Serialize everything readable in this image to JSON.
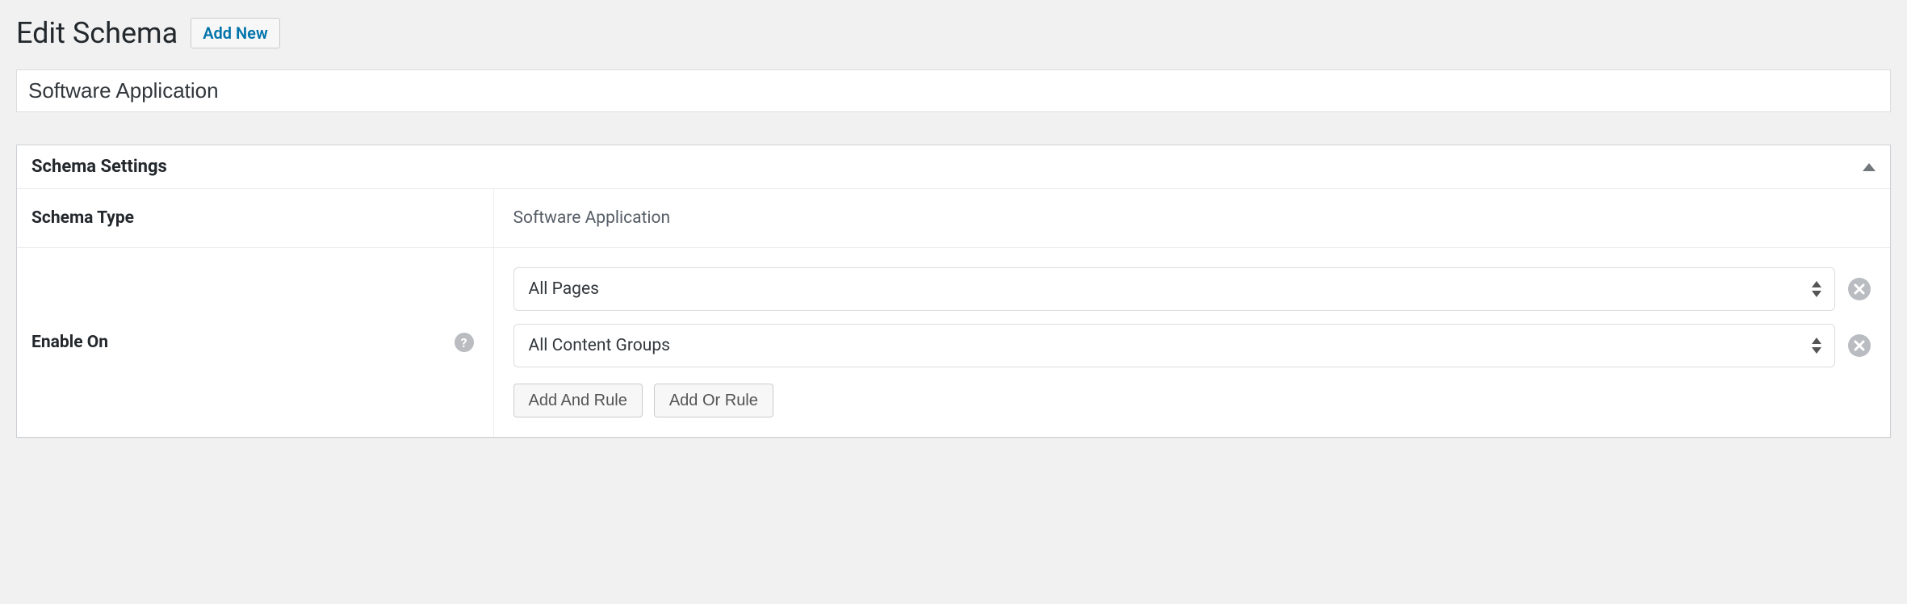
{
  "header": {
    "title": "Edit Schema",
    "add_new_label": "Add New"
  },
  "title_input": {
    "value": "Software Application"
  },
  "settings_box": {
    "heading": "Schema Settings"
  },
  "settings": {
    "schema_type": {
      "label": "Schema Type",
      "value": "Software Application"
    },
    "enable_on": {
      "label": "Enable On",
      "rules": [
        {
          "value": "All Pages"
        },
        {
          "value": "All Content Groups"
        }
      ],
      "add_and_label": "Add And Rule",
      "add_or_label": "Add Or Rule"
    }
  }
}
